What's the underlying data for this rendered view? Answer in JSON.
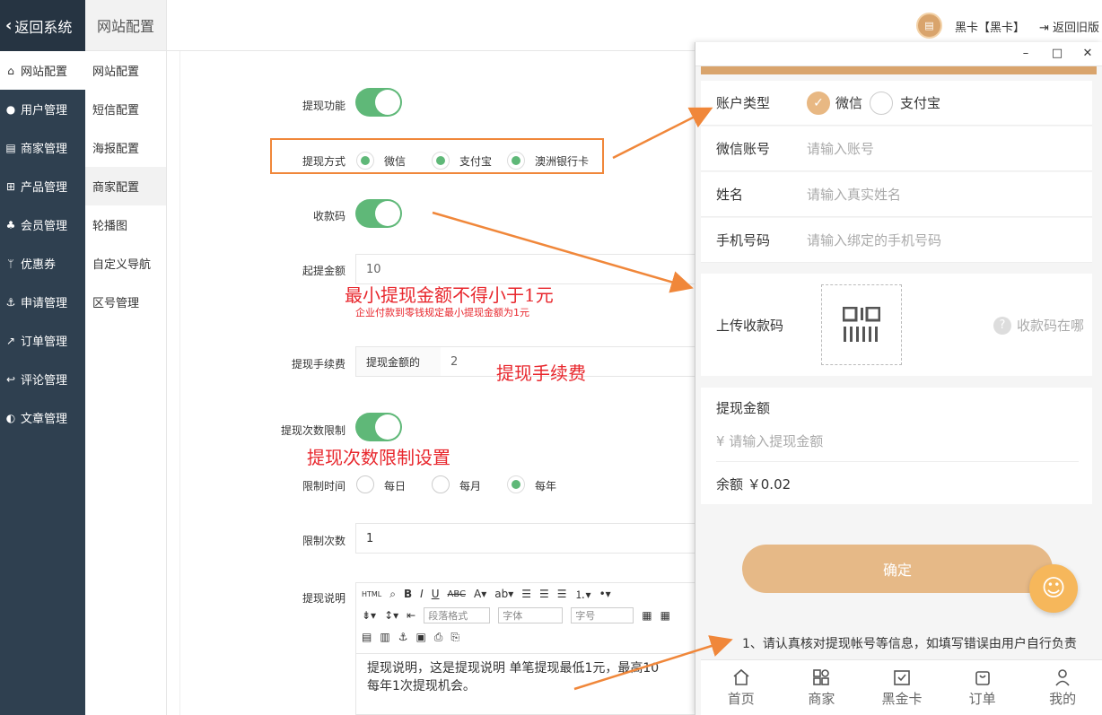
{
  "sidebar": {
    "back_label": "返回系统",
    "items": [
      {
        "label": "网站配置",
        "icon": "home-icon"
      },
      {
        "label": "用户管理",
        "icon": "user-icon"
      },
      {
        "label": "商家管理",
        "icon": "store-icon"
      },
      {
        "label": "产品管理",
        "icon": "cart-icon"
      },
      {
        "label": "会员管理",
        "icon": "members-icon"
      },
      {
        "label": "优惠券",
        "icon": "branch-icon"
      },
      {
        "label": "申请管理",
        "icon": "anchor-icon"
      },
      {
        "label": "订单管理",
        "icon": "share-icon"
      },
      {
        "label": "评论管理",
        "icon": "reply-icon"
      },
      {
        "label": "文章管理",
        "icon": "contrast-icon"
      }
    ]
  },
  "subbar": {
    "title": "网站配置",
    "items": [
      "网站配置",
      "短信配置",
      "海报配置",
      "商家配置",
      "轮播图",
      "自定义导航",
      "区号管理"
    ]
  },
  "topbar": {
    "user": "黑卡【黑卡】",
    "old_version": "返回旧版"
  },
  "form": {
    "withdraw_label": "提现功能",
    "method_label": "提现方式",
    "methods": [
      "微信",
      "支付宝",
      "澳洲银行卡"
    ],
    "qrcode_label": "收款码",
    "min_label": "起提金额",
    "min_value": "10",
    "min_note_big": "最小提现金额不得小于1元",
    "min_note_small": "企业付款到零钱规定最小提现金额为1元",
    "fee_label": "提现手续费",
    "fee_prefix": "提现金额的",
    "fee_value": "2",
    "fee_note": "提现手续费",
    "limit_label": "提现次数限制",
    "limit_note": "提现次数限制设置",
    "limit_time_label": "限制时间",
    "limit_times": [
      "每日",
      "每月",
      "每年"
    ],
    "limit_count_label": "限制次数",
    "limit_count_value": "1",
    "desc_label": "提现说明",
    "editor": {
      "paragraph": "段落格式",
      "font": "字体",
      "size": "字号",
      "content_line1": "提现说明，这是提现说明 单笔提现最低1元，最高10",
      "content_line2": "每年1次提现机会。"
    }
  },
  "phone": {
    "account_type_label": "账户类型",
    "account_types": [
      "微信",
      "支付宝"
    ],
    "wechat_label": "微信账号",
    "wechat_ph": "请输入账号",
    "name_label": "姓名",
    "name_ph": "请输入真实姓名",
    "phone_label": "手机号码",
    "phone_ph": "请输入绑定的手机号码",
    "upload_label": "上传收款码",
    "help_text": "收款码在哪",
    "amount_label": "提现金额",
    "amount_ph": "¥ 请输入提现金额",
    "balance": "余额 ￥0.02",
    "confirm": "确定",
    "notice": "1、请认真核对提现帐号等信息，如填写错误由用户自行负责",
    "tabs": [
      {
        "label": "首页",
        "icon": "home-icon"
      },
      {
        "label": "商家",
        "icon": "grid-icon"
      },
      {
        "label": "黑金卡",
        "icon": "card-check-icon"
      },
      {
        "label": "订单",
        "icon": "bag-icon"
      },
      {
        "label": "我的",
        "icon": "person-icon"
      }
    ]
  },
  "colors": {
    "sidebar": "#2f4050",
    "toggle_on": "#5fb878",
    "accent": "#e6b987",
    "annotation": "#e8272d",
    "arrow": "#f0873a"
  }
}
